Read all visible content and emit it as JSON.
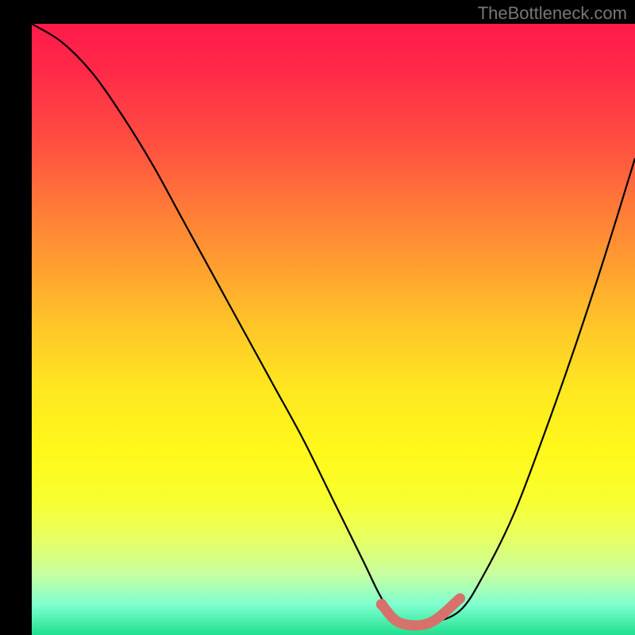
{
  "attribution": "TheBottleneck.com",
  "chart_data": {
    "type": "line",
    "title": "",
    "xlabel": "",
    "ylabel": "",
    "xlim": [
      0,
      100
    ],
    "ylim": [
      0,
      100
    ],
    "series": [
      {
        "name": "bottleneck-curve",
        "x": [
          0,
          5,
          10,
          15,
          20,
          25,
          30,
          35,
          40,
          45,
          50,
          55,
          58,
          61,
          66,
          71,
          75,
          80,
          85,
          90,
          95,
          100
        ],
        "values": [
          100,
          97,
          92,
          85,
          77,
          68,
          59,
          50,
          41,
          32,
          22,
          12,
          6,
          2,
          2,
          4,
          10,
          20,
          33,
          47,
          62,
          78
        ]
      }
    ],
    "emphasis": {
      "name": "highlight-segment",
      "x": [
        58,
        61,
        66,
        71
      ],
      "values": [
        5,
        2,
        2,
        6
      ]
    },
    "marker": {
      "x": 58,
      "y": 5
    },
    "colors": {
      "curve": "#000000",
      "emphasis": "#d6726b",
      "gradient_top": "#ff1a4a",
      "gradient_mid": "#ffe820",
      "gradient_bottom": "#20e090"
    }
  }
}
